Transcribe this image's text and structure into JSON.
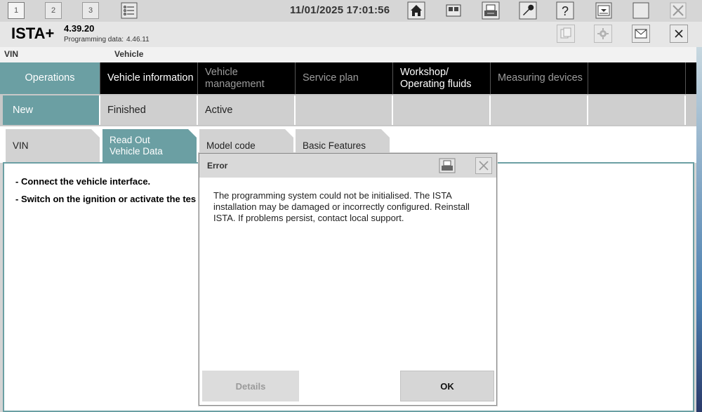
{
  "toolbar": {
    "tabs": [
      "1",
      "2",
      "3"
    ],
    "datetime": "11/01/2025 17:01:56",
    "icons": [
      "list-icon",
      "home-icon",
      "split-view-icon",
      "print-icon",
      "wrench-icon",
      "help-icon",
      "download-icon",
      "window-icon",
      "close-icon"
    ]
  },
  "header": {
    "brand": "ISTA+",
    "version": "4.39.20",
    "programming_label": "Programming data:",
    "programming_version": "4.46.11",
    "icons": [
      "copy-icon",
      "gear-icon",
      "mail-icon",
      "close-icon"
    ]
  },
  "vehicle_strip": {
    "vin_label": "VIN",
    "vehicle_label": "Vehicle"
  },
  "main_nav": [
    {
      "label": "Operations"
    },
    {
      "label": "Vehicle information"
    },
    {
      "label": "Vehicle management"
    },
    {
      "label": "Service plan"
    },
    {
      "label": "Workshop/ Operating fluids"
    },
    {
      "label": "Measuring devices"
    }
  ],
  "sub_nav": [
    {
      "label": "New"
    },
    {
      "label": "Finished"
    },
    {
      "label": "Active"
    }
  ],
  "tabs": [
    {
      "label": "VIN"
    },
    {
      "label": "Read Out Vehicle Data"
    },
    {
      "label": "Model code"
    },
    {
      "label": "Basic Features"
    }
  ],
  "content": {
    "instructions": [
      "- Connect the vehicle interface.",
      "- Switch on the ignition or activate the tes"
    ]
  },
  "dialog": {
    "title": "Error",
    "message": "The programming system could not be initialised. The ISTA installation may be damaged or incorrectly configured. Reinstall ISTA. If problems persist, contact local support.",
    "details_label": "Details",
    "ok_label": "OK"
  },
  "colors": {
    "accent": "#6b9fa3",
    "nav_bg": "#000000",
    "toolbar_bg": "#d6d6d6"
  }
}
